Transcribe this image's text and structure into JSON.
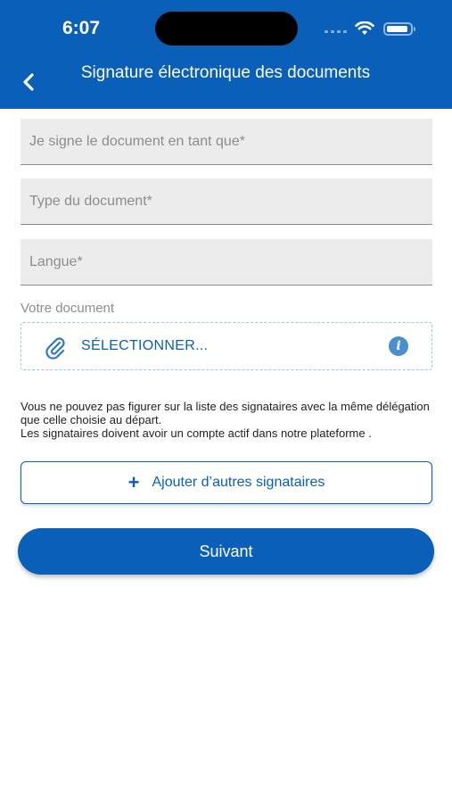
{
  "status_bar": {
    "time": "6:07"
  },
  "header": {
    "title": "Signature électronique des documents"
  },
  "form": {
    "signer_role": {
      "placeholder": "Je signe le document en tant que*",
      "value": ""
    },
    "document_type": {
      "placeholder": "Type du document*",
      "value": ""
    },
    "language": {
      "placeholder": "Langue*",
      "value": ""
    },
    "document_label": "Votre document",
    "select_label": "SÉLECTIONNER..."
  },
  "notice": {
    "line1": "Vous ne pouvez pas figurer sur la liste des signataires avec la même délégation que celle choisie au départ.",
    "line2": "Les signataires doivent avoir un compte actif dans notre plateforme ."
  },
  "buttons": {
    "add_signers": "Ajouter d’autres signataires",
    "next": "Suivant"
  },
  "colors": {
    "primary": "#0a5fb8",
    "field_bg": "#ececec"
  }
}
